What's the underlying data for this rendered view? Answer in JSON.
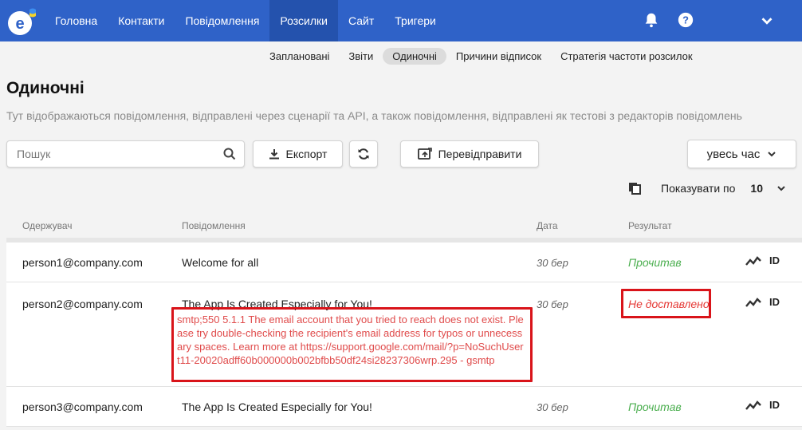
{
  "nav": {
    "items": [
      {
        "label": "Головна",
        "name": "nav-item-home"
      },
      {
        "label": "Контакти",
        "name": "nav-item-contacts"
      },
      {
        "label": "Повідомлення",
        "name": "nav-item-messages"
      },
      {
        "label": "Розсилки",
        "name": "nav-item-mailings"
      },
      {
        "label": "Сайт",
        "name": "nav-item-site"
      },
      {
        "label": "Тригери",
        "name": "nav-item-triggers"
      }
    ],
    "active_index": 3
  },
  "subnav": {
    "items": [
      "Заплановані",
      "Звіти",
      "Одиночні",
      "Причини відписок",
      "Стратегія частоти розсилок"
    ],
    "active_index": 2
  },
  "page": {
    "title": "Одиночні",
    "description": "Тут відображаються повідомлення, відправлені через сценарії та API, а також повідомлення, відправлені як тестові з редакторів повідомлень"
  },
  "toolbar": {
    "search_placeholder": "Пошук",
    "export_label": "Експорт",
    "resend_label": "Перевідправити",
    "period_label": "увесь час"
  },
  "pagination": {
    "label": "Показувати по",
    "value": "10"
  },
  "table": {
    "headers": {
      "recipient": "Одержувач",
      "message": "Повідомлення",
      "date": "Дата",
      "result": "Результат"
    },
    "id_label": "ID",
    "rows": [
      {
        "recipient": "person1@company.com",
        "message": "Welcome for all",
        "error": "",
        "date": "30 бер",
        "result": "Прочитав",
        "status": "read"
      },
      {
        "recipient": "person2@company.com",
        "message": "The App Is Created Especially for You!",
        "error": "smtp;550 5.1.1 The email account that you tried to reach does not exist. Please try double-checking the recipient's email address for typos or unnecessary spaces. Learn more at https://support.google.com/mail/?p=NoSuchUser t11-20020adff60b000000b002bfbb50df24si28237306wrp.295 - gsmtp",
        "date": "30 бер",
        "result": "Не доставлено",
        "status": "failed"
      },
      {
        "recipient": "person3@company.com",
        "message": "The App Is Created Especially for You!",
        "error": "",
        "date": "30 бер",
        "result": "Прочитав",
        "status": "read"
      }
    ]
  },
  "colors": {
    "brand": "#2f62c8",
    "success": "#4caf50",
    "error": "#e53935",
    "highlight": "#d9141a"
  },
  "icons": {
    "logo": "esputnik-logo",
    "notifications": "bell-icon",
    "help": "help-icon",
    "account_menu": "chevron-down-icon",
    "search": "search-icon",
    "export": "download-icon",
    "refresh": "refresh-icon",
    "resend": "resend-icon",
    "copy": "copy-icon",
    "stats": "chart-line-icon"
  }
}
